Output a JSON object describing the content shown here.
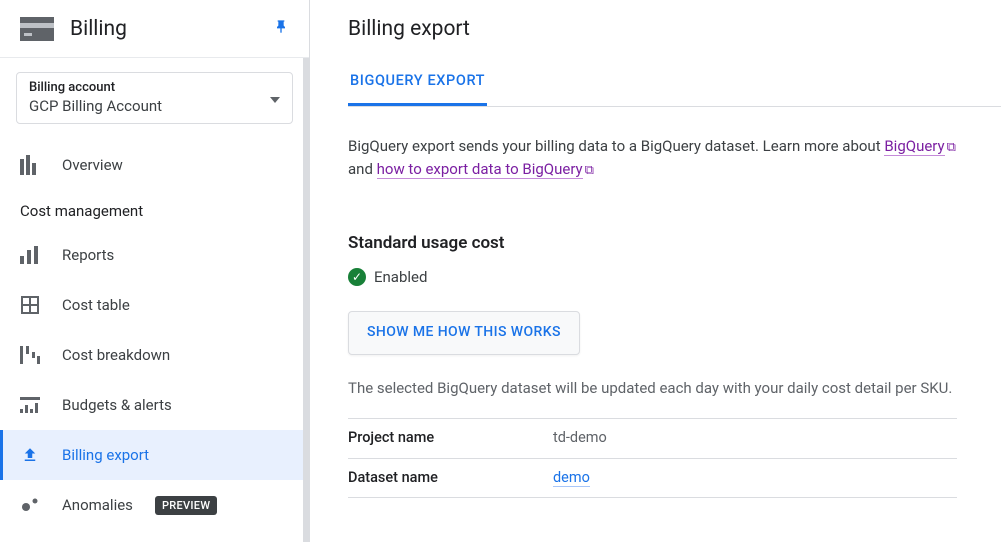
{
  "sidebar": {
    "title": "Billing",
    "account_label": "Billing account",
    "account_value": "GCP Billing Account",
    "overview": "Overview",
    "section_cost": "Cost management",
    "items": [
      {
        "label": "Reports"
      },
      {
        "label": "Cost table"
      },
      {
        "label": "Cost breakdown"
      },
      {
        "label": "Budgets & alerts"
      },
      {
        "label": "Billing export"
      },
      {
        "label": "Anomalies",
        "badge": "PREVIEW"
      }
    ]
  },
  "main": {
    "title": "Billing export",
    "tab": "BIGQUERY EXPORT",
    "desc_prefix": "BigQuery export sends your billing data to a BigQuery dataset. Learn more about ",
    "link1": "BigQuery",
    "desc_mid": " and ",
    "link2": "how to export data to BigQuery",
    "section_title": "Standard usage cost",
    "status": "Enabled",
    "button": "SHOW ME HOW THIS WORKS",
    "desc2": "The selected BigQuery dataset will be updated each day with your daily cost detail per SKU.",
    "kv": {
      "project_key": "Project name",
      "project_val": "td-demo",
      "dataset_key": "Dataset name",
      "dataset_val": "demo"
    }
  }
}
